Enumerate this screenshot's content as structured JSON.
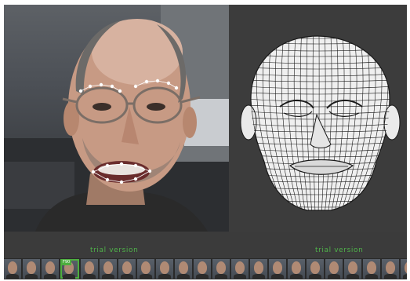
{
  "video": {
    "tracking_color": "#ffffff"
  },
  "viewport": {
    "mesh_color": "#f2f2f2",
    "wire_color": "#1a1a1a"
  },
  "trial": {
    "left_label": "trial version",
    "right_label": "trial version",
    "color": "#4fb24a"
  },
  "filmstrip": {
    "selected_tag": "F90",
    "frames": 22,
    "selected_index": 3,
    "accent": "#4dae3f"
  }
}
